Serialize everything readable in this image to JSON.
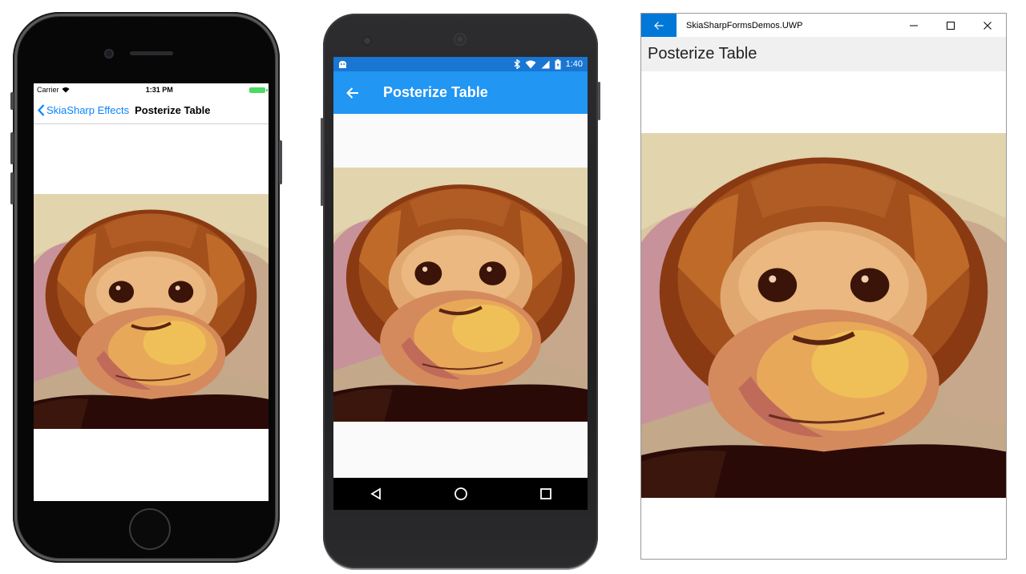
{
  "ios": {
    "carrier": "Carrier",
    "time": "1:31 PM",
    "back_label": "SkiaSharp Effects",
    "title": "Posterize Table"
  },
  "android": {
    "time": "1:40",
    "title": "Posterize Table",
    "status_color": "#1976d2",
    "appbar_color": "#2196f3"
  },
  "uwp": {
    "app_title": "SkiaSharpFormsDemos.UWP",
    "page_title": "Posterize Table",
    "accent_color": "#0078d7",
    "minimize_icon": "–",
    "maximize_icon": "☐",
    "close_icon": "✕"
  },
  "image": {
    "subject": "posterized-monkey-photo"
  }
}
